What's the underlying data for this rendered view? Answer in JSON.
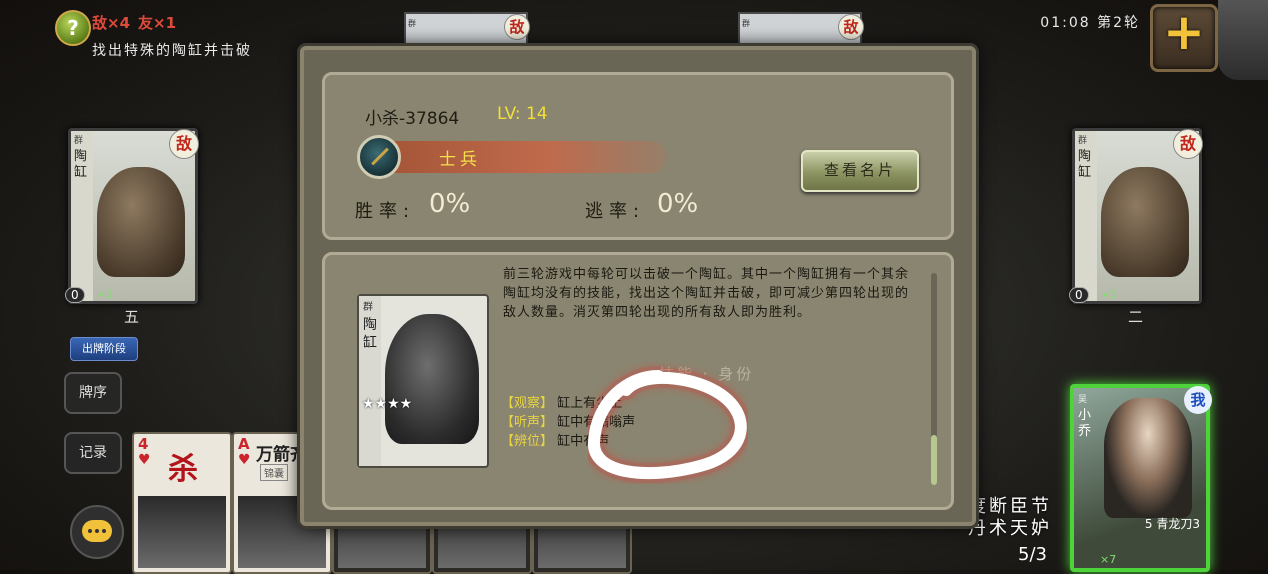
{
  "hud": {
    "help_symbol": "?",
    "enemy_count": "敌×4",
    "ally_count": "友×1",
    "mission": "找出特殊的陶缸并击破",
    "timer": "01:08 第2轮",
    "add_symbol": "+"
  },
  "top_players": [
    {
      "faction": "群",
      "flag": "敌"
    },
    {
      "faction": "群",
      "flag": "敌"
    }
  ],
  "left_player": {
    "faction": "群",
    "name": "陶缸",
    "flag": "敌",
    "hand": "0",
    "x": "×1",
    "seat": "五"
  },
  "right_player": {
    "faction": "群",
    "name": "陶缸",
    "flag": "敌",
    "hand": "0",
    "x": "×1",
    "seat": "二"
  },
  "left_tools": {
    "phase": "出牌阶段",
    "sort": "牌序",
    "log": "记录"
  },
  "hand_cards": [
    {
      "rank": "4",
      "suit": "♥",
      "title": "杀",
      "sub": ""
    },
    {
      "rank": "A",
      "suit": "♥",
      "title": "万箭齐发",
      "sub": "锦囊"
    },
    {
      "rank": "",
      "suit": "",
      "title": "",
      "sub": ""
    },
    {
      "rank": "",
      "suit": "",
      "title": "",
      "sub": ""
    },
    {
      "rank": "",
      "suit": "",
      "title": "",
      "sub": ""
    }
  ],
  "self_player": {
    "faction": "吴",
    "name": "小乔",
    "flag": "我",
    "weapon": "5 青龙刀3",
    "x": "×7",
    "skills": [
      "度断",
      "臣节",
      "丹术",
      "天妒"
    ],
    "hand_count": "5/3"
  },
  "dialog": {
    "player_name": "小杀-37864",
    "level": "LV: 14",
    "rank_title": "士兵",
    "view_card_button": "查看名片",
    "win_rate_label": "胜率:",
    "win_rate_value": "0%",
    "escape_rate_label": "逃率:",
    "escape_rate_value": "0%",
    "jar_card": {
      "faction": "群",
      "name": "陶缸",
      "stars": "★★★★"
    },
    "description": "前三轮游戏中每轮可以击破一个陶缸。其中一个陶缸拥有一个其余陶缸均没有的技能，找出这个陶缸并击破，即可减少第四轮出现的敌人数量。消灭第四轮出现的所有敌人即为胜利。",
    "skill_header": "技能 · 身份",
    "skills": [
      {
        "tag": "【观察】",
        "text": "缸上有尘土"
      },
      {
        "tag": "【听声】",
        "text": "缸中有嗡嗡声"
      },
      {
        "tag": "【辨位】",
        "text": "缸中有声"
      }
    ]
  },
  "colors": {
    "dialog_bg": "#6a6656",
    "panel_bg": "#8a8570",
    "level_yellow": "#f3df36",
    "enemy_red": "#c0281d",
    "self_green": "#4fd33b",
    "annotation_white": "#ffffff"
  }
}
